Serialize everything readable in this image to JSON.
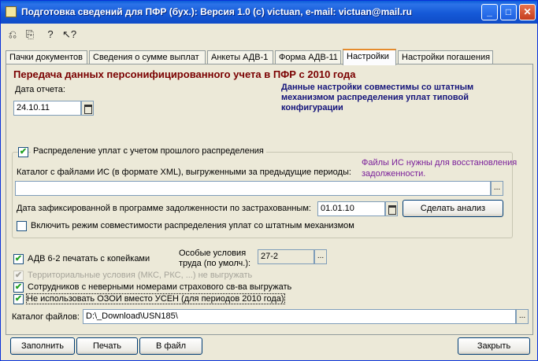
{
  "window": {
    "title": "Подготовка сведений для ПФР (бух.): Версия 1.0 (c) victuan, e-mail: victuan@mail.ru",
    "minimize_glyph": "_",
    "maximize_glyph": "□",
    "close_glyph": "✕"
  },
  "toolbar": {
    "icons": [
      "cut-icon",
      "paste-icon",
      "help-icon",
      "whats-this-icon"
    ],
    "glyphs": [
      "⎌",
      "⎘",
      "?",
      "↖?"
    ]
  },
  "tabs": [
    {
      "label": "Пачки документов"
    },
    {
      "label": "Сведения о сумме выплат"
    },
    {
      "label": "Анкеты АДВ-1"
    },
    {
      "label": "Форма АДВ-11"
    },
    {
      "label": "Настройки",
      "active": true
    },
    {
      "label": "Настройки погашения"
    }
  ],
  "settings": {
    "heading": "Передача данных персонифицированного учета в ПФР с 2010 года",
    "report_date_label": "Дата отчета:",
    "report_date_value": "24.10.11",
    "compat_note": "Данные настройки совместимы со штатным механизмом распределения уплат типовой конфигурации",
    "distribution": {
      "checkbox_label": "Распределение уплат с учетом прошлого распределения",
      "checked": true,
      "catalog_label": "Каталог с файлами ИС (в формате XML), выгруженными за предыдущие периоды:",
      "catalog_value": "",
      "purple_note": "Файлы ИС нужны для восстановления задолженности.",
      "fixed_debt_label": "Дата зафиксированной в программе задолженности по застрахованным:",
      "fixed_debt_date": "01.01.10",
      "analyze_button": "Сделать анализ",
      "compat_mode_label": "Включить режим совместимости распределения уплат со штатным механизмом",
      "compat_mode_checked": false
    },
    "adv62_label": "АДВ 6-2 печатать с копейками",
    "adv62_checked": true,
    "special_conditions_label": "Особые условия труда (по умолч.):",
    "special_conditions_value": "27-2",
    "territorial_label": "Территориальные условия (МКС, РКС, ...) не выгружать",
    "territorial_checked": true,
    "wrong_numbers_label": "Сотрудников с неверными номерами страхового св-ва выгружать",
    "wrong_numbers_checked": true,
    "ozoi_label": "Не использовать ОЗОИ вместо УСЕН (для периодов 2010 года)",
    "ozoi_checked": true,
    "files_catalog_label": "Каталог файлов:",
    "files_catalog_value": "D:\\_Download\\USN185\\"
  },
  "footer": {
    "fill_button": "Заполнить",
    "print_button": "Печать",
    "to_file_button": "В файл",
    "close_button": "Закрыть"
  },
  "colors": {
    "title_blue": "#0a5bd8",
    "heading_red": "#7a0000",
    "note_blue": "#13137a",
    "note_purple": "#7a1f9a",
    "check_green": "#21a121"
  }
}
